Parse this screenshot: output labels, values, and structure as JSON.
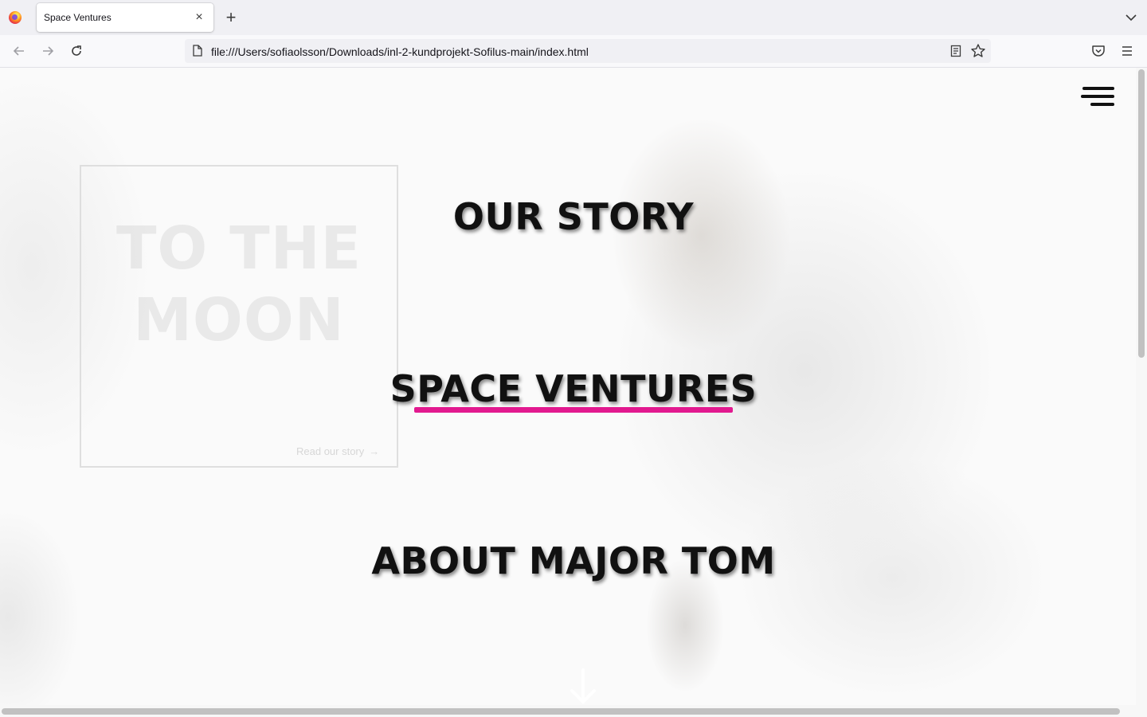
{
  "browser": {
    "tab_title": "Space Ventures",
    "close_tab_label": "×",
    "new_tab_label": "+",
    "url": "file:///Users/sofiaolsson/Downloads/inl-2-kundprojekt-Sofilus-main/index.html"
  },
  "hero": {
    "title_line1": "TO THE",
    "title_line2": "MOON",
    "link_label": "Read our story",
    "link_arrow": "→"
  },
  "menu": {
    "items": [
      {
        "label": "OUR STORY",
        "active": false
      },
      {
        "label": "SPACE VENTURES",
        "active": true
      },
      {
        "label": "ABOUT MAJOR TOM",
        "active": false
      }
    ]
  },
  "colors": {
    "active_underline": "#e2198f",
    "text": "#111111"
  },
  "icons": {
    "menu": "hamburger-menu-icon",
    "scroll": "arrow-down-icon"
  }
}
